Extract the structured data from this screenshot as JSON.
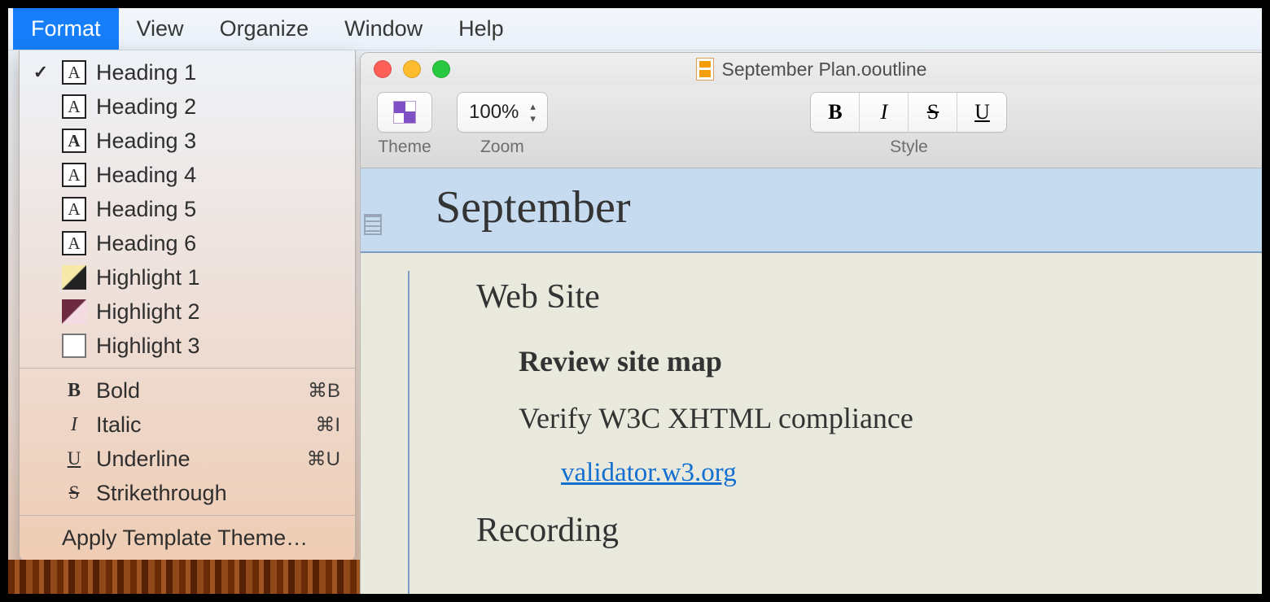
{
  "menubar": {
    "items": [
      "Format",
      "View",
      "Organize",
      "Window",
      "Help"
    ],
    "selected_index": 0
  },
  "dropdown": {
    "headings": [
      {
        "label": "Heading 1",
        "checked": true,
        "bold": false
      },
      {
        "label": "Heading 2",
        "checked": false,
        "bold": false
      },
      {
        "label": "Heading 3",
        "checked": false,
        "bold": true
      },
      {
        "label": "Heading 4",
        "checked": false,
        "bold": false
      },
      {
        "label": "Heading 5",
        "checked": false,
        "bold": false
      },
      {
        "label": "Heading 6",
        "checked": false,
        "bold": false
      }
    ],
    "highlights": [
      {
        "label": "Highlight 1",
        "swatch": "hl1"
      },
      {
        "label": "Highlight 2",
        "swatch": "hl2"
      },
      {
        "label": "Highlight 3",
        "swatch": "hl3"
      }
    ],
    "styles": [
      {
        "label": "Bold",
        "icon": "bold-i",
        "shortcut": "⌘B"
      },
      {
        "label": "Italic",
        "icon": "italic-i",
        "shortcut": "⌘I"
      },
      {
        "label": "Underline",
        "icon": "under-i",
        "shortcut": "⌘U"
      },
      {
        "label": "Strikethrough",
        "icon": "strike-i",
        "shortcut": ""
      }
    ],
    "apply_theme": "Apply Template Theme…"
  },
  "window": {
    "title": "September Plan.ooutline"
  },
  "toolbar": {
    "theme_label": "Theme",
    "zoom_label": "Zoom",
    "zoom_value": "100%",
    "style_label": "Style",
    "style_buttons": {
      "bold": "B",
      "italic": "I",
      "strike": "S",
      "underline": "U"
    }
  },
  "document": {
    "header": "September",
    "section": "Web Site",
    "row1": "Review site map",
    "row2": "Verify W3C XHTML compliance",
    "link": "validator.w3.org",
    "section2": "Recording"
  }
}
